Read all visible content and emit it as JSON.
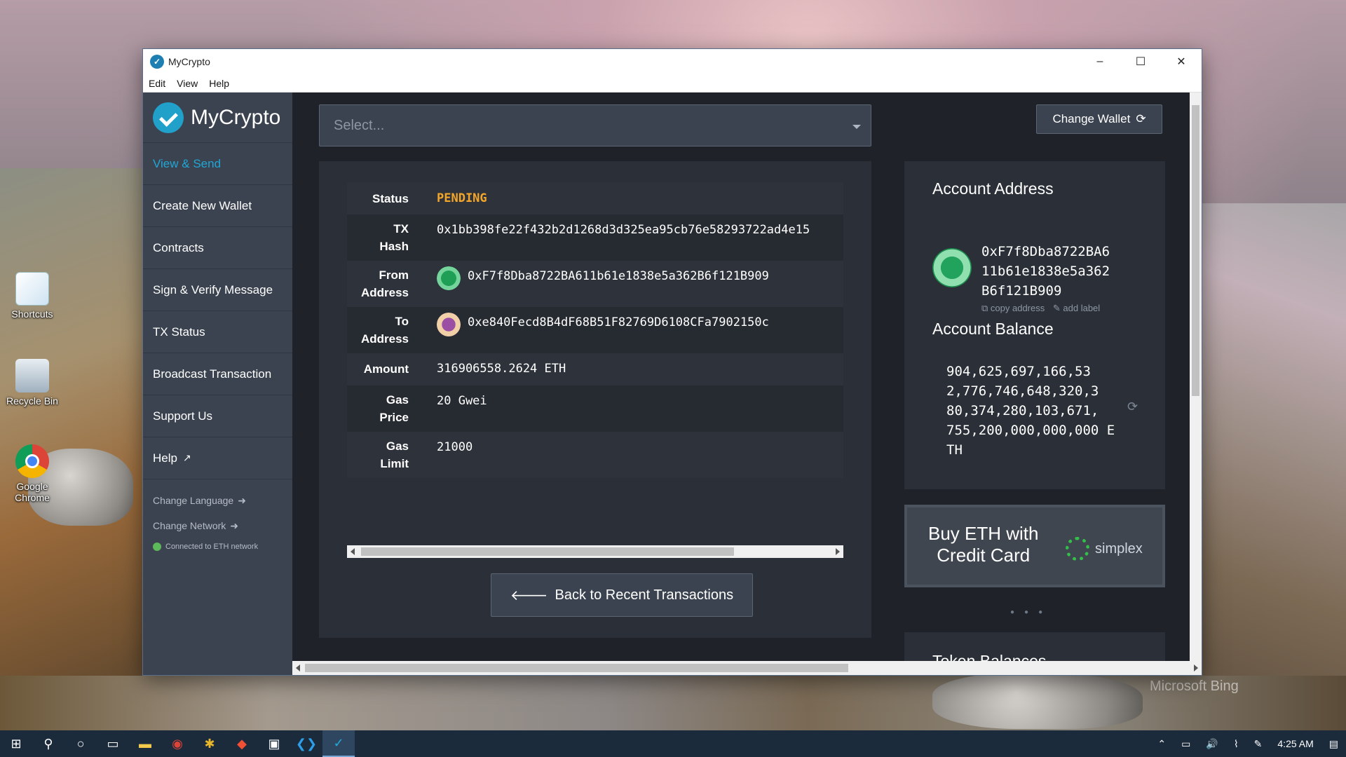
{
  "window": {
    "title": "MyCrypto",
    "controls": [
      "–",
      "☐",
      "✕"
    ]
  },
  "menu": [
    "Edit",
    "View",
    "Help"
  ],
  "sidebar": {
    "brand": "MyCrypto",
    "items": [
      {
        "label": "View & Send",
        "active": true
      },
      {
        "label": "Create New Wallet"
      },
      {
        "label": "Contracts"
      },
      {
        "label": "Sign & Verify Message"
      },
      {
        "label": "TX Status"
      },
      {
        "label": "Broadcast Transaction"
      },
      {
        "label": "Support Us"
      },
      {
        "label": "Help"
      }
    ],
    "change_language": "Change Language",
    "change_network": "Change Network",
    "status": "Connected to ETH network"
  },
  "wallet_select": {
    "placeholder": "Select..."
  },
  "change_wallet": "Change Wallet",
  "tx": {
    "status_label": "Status",
    "status_value": "PENDING",
    "hash_label_1": "TX",
    "hash_label_2": "Hash",
    "hash_value": "0x1bb398fe22f432b2d1268d3d325ea95cb76e58293722ad4e15",
    "from_label_1": "From",
    "from_label_2": "Address",
    "from_value": "0xF7f8Dba8722BA611b61e1838e5a362B6f121B909",
    "to_label_1": "To",
    "to_label_2": "Address",
    "to_value": "0xe840Fecd8B4dF68B51F82769D6108CFa7902150c",
    "amount_label": "Amount",
    "amount_value": "316906558.2624 ETH",
    "gasprice_label_1": "Gas",
    "gasprice_label_2": "Price",
    "gasprice_value": "20 Gwei",
    "gaslimit_label_1": "Gas",
    "gaslimit_label_2": "Limit",
    "gaslimit_value": "21000"
  },
  "back_button": "Back to Recent Transactions",
  "account": {
    "address_title": "Account Address",
    "address_lines": [
      "0xF7f8Dba8722BA6",
      "11b61e1838e5a362",
      "B6f121B909"
    ],
    "copy_address": "copy address",
    "add_label": "add label",
    "balance_title": "Account Balance",
    "balance_lines": [
      "904,625,697,166,53",
      "2,776,746,648,320,3",
      "80,374,280,103,671,",
      "755,200,000,000,000 E",
      "TH"
    ]
  },
  "promo": {
    "line1": "Buy ETH with",
    "line2": "Credit Card",
    "brand": "simplex"
  },
  "token_balances_title": "Token Balances",
  "desktop": [
    "Shortcuts",
    "Recycle Bin",
    "Google Chrome"
  ],
  "watermark": "Microsoft Bing",
  "taskbar": {
    "time": "4:25 AM"
  },
  "colors": {
    "accent": "#21a6d6",
    "pending": "#f4a62a",
    "connected": "#5dba5a"
  }
}
